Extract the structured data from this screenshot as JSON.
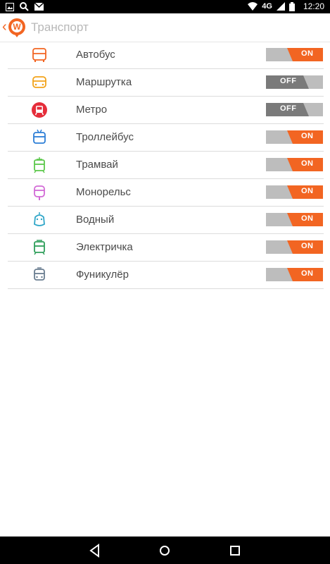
{
  "status_bar": {
    "time": "12:20",
    "network": "4G",
    "icons": [
      "gallery-icon",
      "search-icon",
      "mail-icon",
      "wifi-icon",
      "signal-icon",
      "battery-icon"
    ]
  },
  "app_bar": {
    "title": "Транспорт",
    "logo_letter": "W"
  },
  "colors": {
    "accent": "#f26522",
    "toggle_off": "#bdbdbd",
    "toggle_off_dark": "#7a7a7a"
  },
  "transport_items": [
    {
      "label": "Автобус",
      "icon": "bus-icon",
      "color": "#f26522",
      "state": "ON"
    },
    {
      "label": "Маршрутка",
      "icon": "minibus-icon",
      "color": "#f2a31a",
      "state": "OFF"
    },
    {
      "label": "Метро",
      "icon": "metro-icon",
      "color": "#e52d3a",
      "state": "OFF"
    },
    {
      "label": "Троллейбус",
      "icon": "trolleybus-icon",
      "color": "#2c7ed6",
      "state": "ON"
    },
    {
      "label": "Трамвай",
      "icon": "tram-icon",
      "color": "#5cc84b",
      "state": "ON"
    },
    {
      "label": "Монорельс",
      "icon": "monorail-icon",
      "color": "#d26ad6",
      "state": "ON"
    },
    {
      "label": "Водный",
      "icon": "boat-icon",
      "color": "#2fa6c8",
      "state": "ON"
    },
    {
      "label": "Электричка",
      "icon": "train-icon",
      "color": "#2e9e5a",
      "state": "ON"
    },
    {
      "label": "Фуникулёр",
      "icon": "funicular-icon",
      "color": "#6a7d90",
      "state": "ON"
    }
  ],
  "nav_bar": {
    "buttons": [
      "back-nav-icon",
      "home-nav-icon",
      "recents-nav-icon"
    ]
  }
}
